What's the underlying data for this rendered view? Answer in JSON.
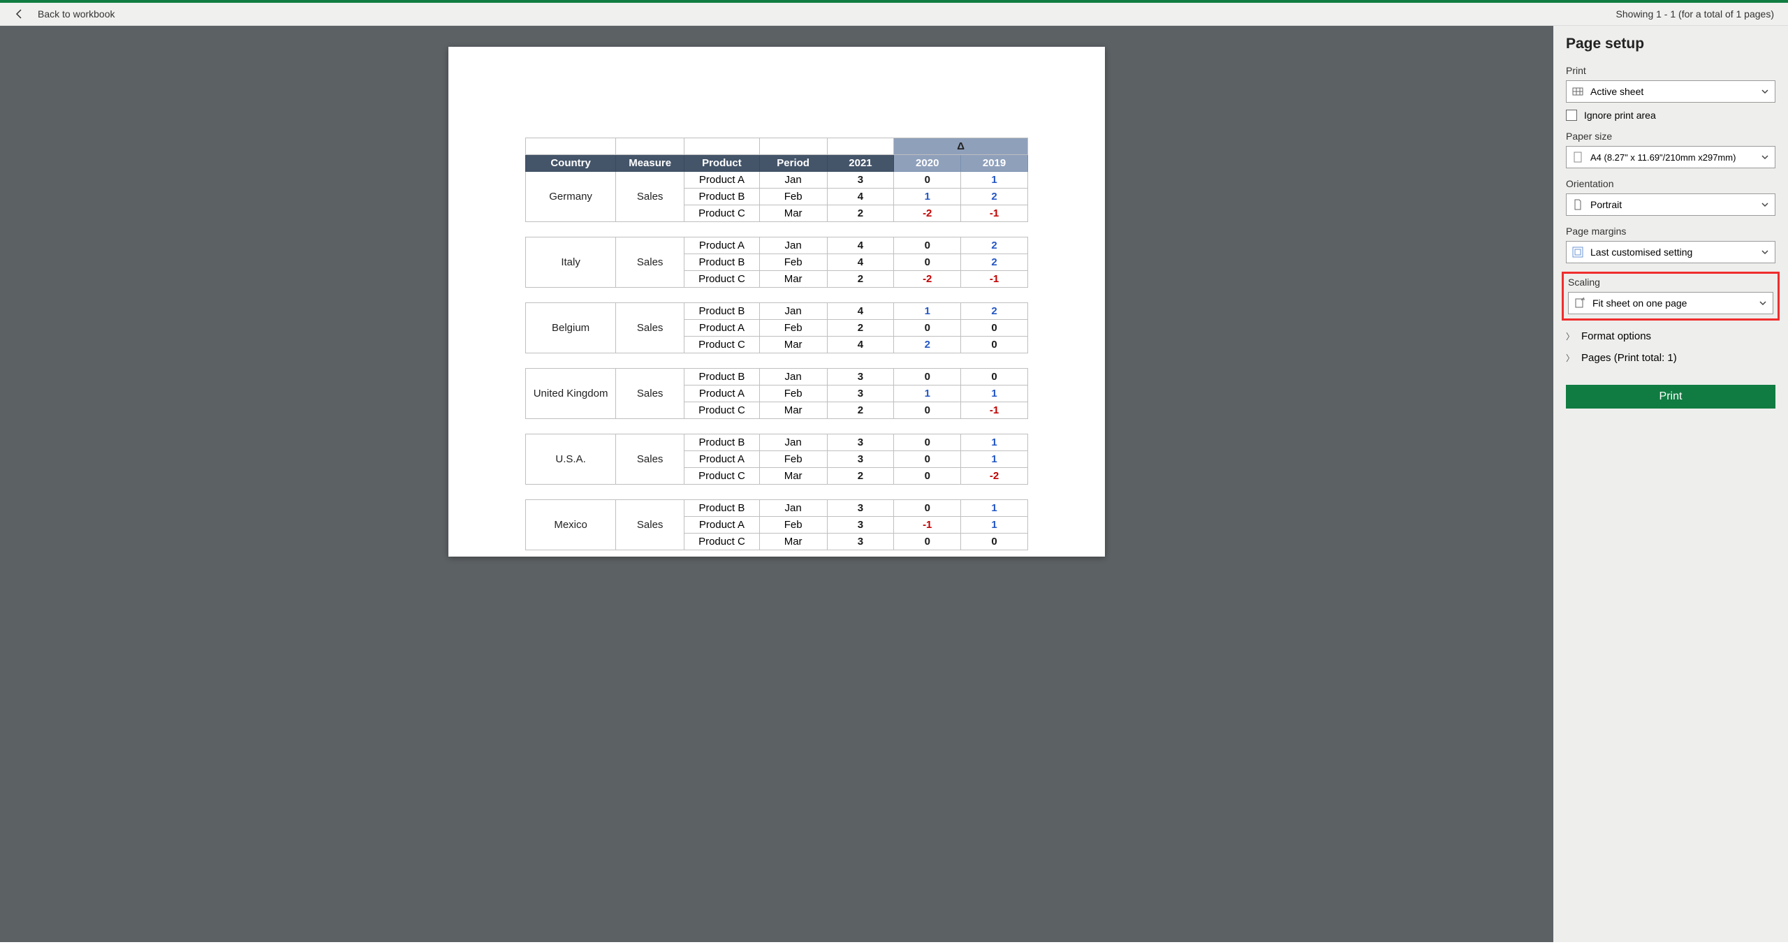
{
  "header": {
    "back_label": "Back to workbook",
    "showing": "Showing 1 - 1 (for a total of 1 pages)"
  },
  "report": {
    "delta_symbol": "Δ",
    "columns": {
      "country": "Country",
      "measure": "Measure",
      "product": "Product",
      "period": "Period",
      "y2021": "2021",
      "y2020": "2020",
      "y2019": "2019"
    },
    "blocks": [
      {
        "country": "Germany",
        "measure": "Sales",
        "rows": [
          {
            "product": "Product A",
            "period": "Jan",
            "v2021": "3",
            "v2020": "0",
            "v2019": "1",
            "c2020": "black",
            "c2019": "blue"
          },
          {
            "product": "Product B",
            "period": "Feb",
            "v2021": "4",
            "v2020": "1",
            "v2019": "2",
            "c2020": "blue",
            "c2019": "blue"
          },
          {
            "product": "Product C",
            "period": "Mar",
            "v2021": "2",
            "v2020": "-2",
            "v2019": "-1",
            "c2020": "red",
            "c2019": "red"
          }
        ]
      },
      {
        "country": "Italy",
        "measure": "Sales",
        "rows": [
          {
            "product": "Product A",
            "period": "Jan",
            "v2021": "4",
            "v2020": "0",
            "v2019": "2",
            "c2020": "black",
            "c2019": "blue"
          },
          {
            "product": "Product B",
            "period": "Feb",
            "v2021": "4",
            "v2020": "0",
            "v2019": "2",
            "c2020": "black",
            "c2019": "blue"
          },
          {
            "product": "Product C",
            "period": "Mar",
            "v2021": "2",
            "v2020": "-2",
            "v2019": "-1",
            "c2020": "red",
            "c2019": "red"
          }
        ]
      },
      {
        "country": "Belgium",
        "measure": "Sales",
        "rows": [
          {
            "product": "Product B",
            "period": "Jan",
            "v2021": "4",
            "v2020": "1",
            "v2019": "2",
            "c2020": "blue",
            "c2019": "blue"
          },
          {
            "product": "Product A",
            "period": "Feb",
            "v2021": "2",
            "v2020": "0",
            "v2019": "0",
            "c2020": "black",
            "c2019": "black"
          },
          {
            "product": "Product C",
            "period": "Mar",
            "v2021": "4",
            "v2020": "2",
            "v2019": "0",
            "c2020": "blue",
            "c2019": "black"
          }
        ]
      },
      {
        "country": "United Kingdom",
        "measure": "Sales",
        "rows": [
          {
            "product": "Product B",
            "period": "Jan",
            "v2021": "3",
            "v2020": "0",
            "v2019": "0",
            "c2020": "black",
            "c2019": "black"
          },
          {
            "product": "Product A",
            "period": "Feb",
            "v2021": "3",
            "v2020": "1",
            "v2019": "1",
            "c2020": "blue",
            "c2019": "blue"
          },
          {
            "product": "Product C",
            "period": "Mar",
            "v2021": "2",
            "v2020": "0",
            "v2019": "-1",
            "c2020": "black",
            "c2019": "red"
          }
        ]
      },
      {
        "country": "U.S.A.",
        "measure": "Sales",
        "rows": [
          {
            "product": "Product B",
            "period": "Jan",
            "v2021": "3",
            "v2020": "0",
            "v2019": "1",
            "c2020": "black",
            "c2019": "blue"
          },
          {
            "product": "Product A",
            "period": "Feb",
            "v2021": "3",
            "v2020": "0",
            "v2019": "1",
            "c2020": "black",
            "c2019": "blue"
          },
          {
            "product": "Product C",
            "period": "Mar",
            "v2021": "2",
            "v2020": "0",
            "v2019": "-2",
            "c2020": "black",
            "c2019": "red"
          }
        ]
      },
      {
        "country": "Mexico",
        "measure": "Sales",
        "rows": [
          {
            "product": "Product B",
            "period": "Jan",
            "v2021": "3",
            "v2020": "0",
            "v2019": "1",
            "c2020": "black",
            "c2019": "blue"
          },
          {
            "product": "Product A",
            "period": "Feb",
            "v2021": "3",
            "v2020": "-1",
            "v2019": "1",
            "c2020": "red",
            "c2019": "blue"
          },
          {
            "product": "Product C",
            "period": "Mar",
            "v2021": "3",
            "v2020": "0",
            "v2019": "0",
            "c2020": "black",
            "c2019": "black"
          }
        ]
      }
    ]
  },
  "panel": {
    "title": "Page setup",
    "print_label": "Print",
    "print_value": "Active sheet",
    "ignore_print_area": "Ignore print area",
    "paper_size_label": "Paper size",
    "paper_size_value": "A4 (8.27\" x 11.69\"/210mm x297mm)",
    "orientation_label": "Orientation",
    "orientation_value": "Portrait",
    "margins_label": "Page margins",
    "margins_value": "Last customised setting",
    "scaling_label": "Scaling",
    "scaling_value": "Fit sheet on one page",
    "format_options": "Format options",
    "pages_label": "Pages (Print total: 1)",
    "print_button": "Print"
  }
}
